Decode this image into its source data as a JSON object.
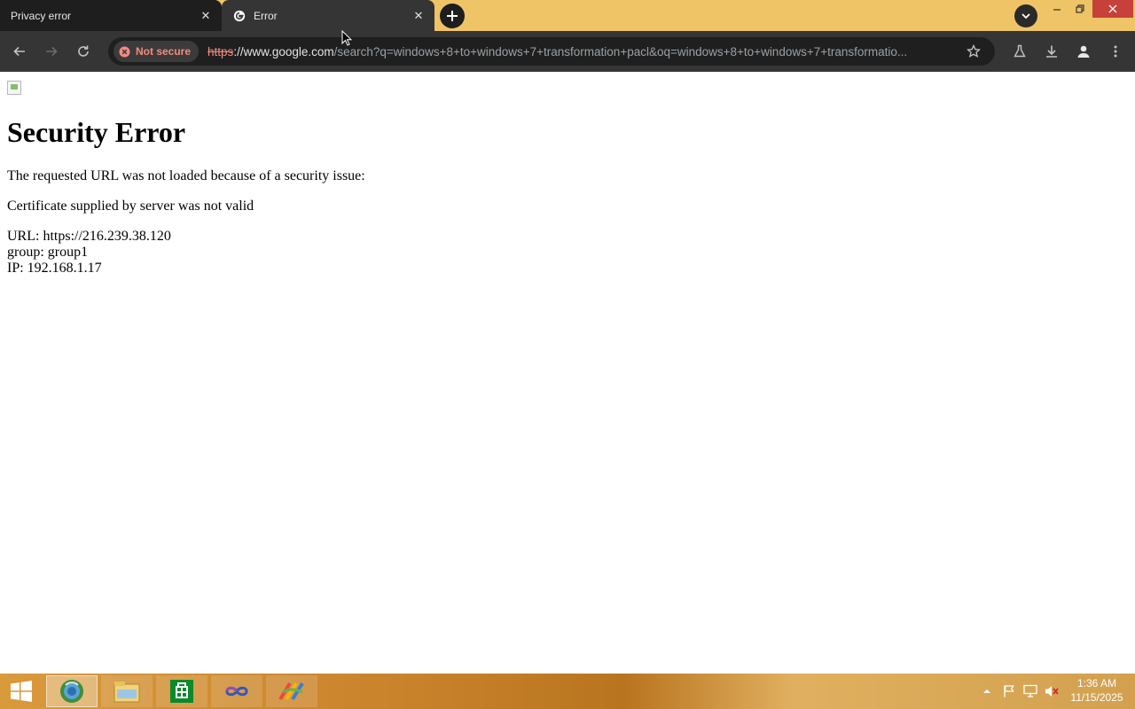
{
  "tabs": [
    {
      "title": "Privacy error",
      "favicon": "none",
      "active": false
    },
    {
      "title": "Error",
      "favicon": "google-icon",
      "active": true
    }
  ],
  "omnibox": {
    "security_chip": "Not secure",
    "url_scheme": "https",
    "url_host": "://www.google.com",
    "url_rest": "/search?q=windows+8+to+windows+7+transformation+pacl&oq=windows+8+to+windows+7+transformatio..."
  },
  "page": {
    "heading": "Security Error",
    "message": "The requested URL was not loaded because of a security issue:",
    "reason": "Certificate supplied by server was not valid",
    "url_line": "URL: https://216.239.38.120",
    "group_line": "group: group1",
    "ip_line": "IP: 192.168.1.17"
  },
  "taskbar": {
    "apps": [
      "chrome-icon",
      "file-explorer-icon",
      "store-icon",
      "app-infinity-icon",
      "app-paint-icon"
    ],
    "clock_time": "1:36 AM",
    "clock_date": "11/15/2025"
  },
  "colors": {
    "tabstrip": "#eec466",
    "toolbar": "#353535",
    "insecure": "#f28b82",
    "close_button": "#c7403a"
  }
}
